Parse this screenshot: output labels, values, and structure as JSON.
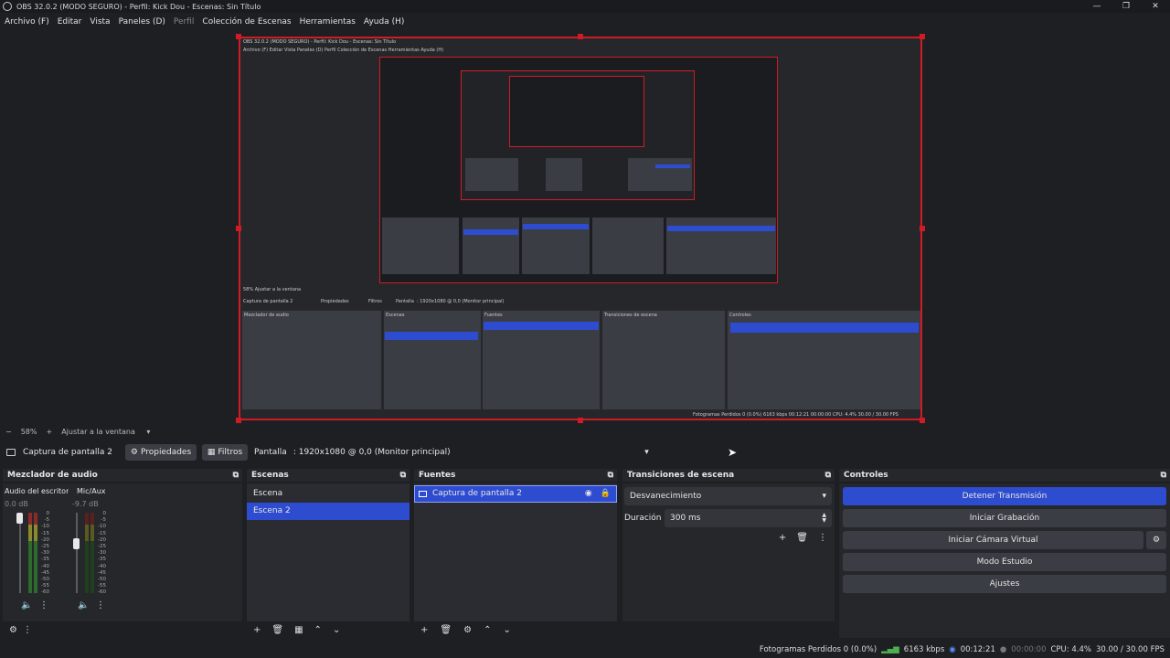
{
  "window": {
    "title": "OBS 32.0.2 (MODO SEGURO) - Perfil: Kick Dou - Escenas: Sin Título",
    "controls": [
      "—",
      "❐",
      "✕"
    ]
  },
  "menu": [
    {
      "label": "Archivo (F)",
      "dim": false
    },
    {
      "label": "Editar",
      "dim": false
    },
    {
      "label": "Vista",
      "dim": false
    },
    {
      "label": "Paneles (D)",
      "dim": false
    },
    {
      "label": "Perfil",
      "dim": true
    },
    {
      "label": "Colección de Escenas",
      "dim": false
    },
    {
      "label": "Herramientas",
      "dim": false
    },
    {
      "label": "Ayuda (H)",
      "dim": false
    }
  ],
  "preview_nested": {
    "title": "OBS 32.0.2 (MODO SEGURO) - Perfil: Kick Dou - Escenas: Sin Título",
    "menu": "Archivo (F)   Editar   Vista   Paneles (D)   Perfil   Colección de Escenas   Herramientas   Ayuda (H)",
    "zoom": "58%   Ajustar a la ventana",
    "source": "Captura de pantalla 2",
    "props": "Propiedades",
    "filters": "Filtros",
    "pantalla": "Pantalla",
    "display": ": 1920x1080 @ 0,0 (Monitor principal)",
    "docks": [
      "Mezclador de audio",
      "Escenas",
      "Fuentes",
      "Transiciones de escena",
      "Controles"
    ],
    "status": "Fotogramas Perdidos 0 (0.0%)   6163 kbps   00:12:21   00:00:00   CPU: 4.4%   30.00 / 30.00 FPS"
  },
  "zoom": {
    "minus": "−",
    "value": "58%",
    "plus": "+",
    "fit": "Ajustar a la ventana"
  },
  "sourcebar": {
    "source_name": "Captura de pantalla 2",
    "properties": "Propiedades",
    "filters": "Filtros",
    "display_label": "Pantalla",
    "display_value": ": 1920x1080 @ 0,0 (Monitor principal)"
  },
  "audio_mixer": {
    "title": "Mezclador de audio",
    "channels": [
      {
        "name": "Audio del escritorio",
        "db": "0.0 dB",
        "level": 1.0
      },
      {
        "name": "Mic/Aux",
        "db": "-9.7 dB",
        "level": 0.6
      }
    ],
    "scale": [
      "0",
      "-5",
      "-10",
      "-15",
      "-20",
      "-25",
      "-30",
      "-35",
      "-40",
      "-45",
      "-50",
      "-55",
      "-60"
    ]
  },
  "scenes": {
    "title": "Escenas",
    "items": [
      "Escena",
      "Escena 2"
    ],
    "selected": 1
  },
  "sources": {
    "title": "Fuentes",
    "items": [
      "Captura de pantalla 2"
    ]
  },
  "transitions": {
    "title": "Transiciones de escena",
    "type": "Desvanecimiento",
    "duration_label": "Duración",
    "duration_value": "300 ms"
  },
  "controls": {
    "title": "Controles",
    "stop_stream": "Detener Transmisión",
    "start_recording": "Iniciar Grabación",
    "virtual_cam": "Iniciar Cámara Virtual",
    "studio_mode": "Modo Estudio",
    "settings": "Ajustes"
  },
  "status": {
    "dropped": "Fotogramas Perdidos 0 (0.0%)",
    "bitrate": "6163 kbps",
    "stream_time": "00:12:21",
    "rec_time": "00:00:00",
    "cpu": "CPU: 4.4%",
    "fps": "30.00 / 30.00 FPS"
  },
  "colors": {
    "accent": "#2e4ccf",
    "selection_border": "#d01b26",
    "bg": "#1e1f22",
    "panel": "#2a2c31"
  }
}
